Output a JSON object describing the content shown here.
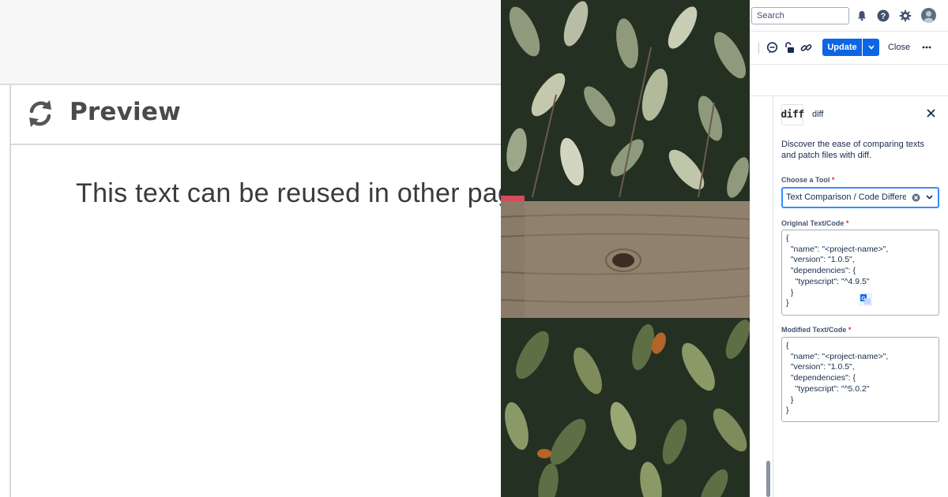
{
  "preview": {
    "title": "Preview",
    "body_text": "This text can be reused in other pages, m"
  },
  "topbar": {
    "search_placeholder": "Search",
    "icons": [
      "bell-icon",
      "help-icon",
      "settings-icon",
      "avatar"
    ]
  },
  "toolbar": {
    "icons": [
      "comment-icon",
      "unlock-icon",
      "link-icon"
    ],
    "update_label": "Update",
    "close_label": "Close",
    "accent": "#0c66e4"
  },
  "panel": {
    "app_logo_text": "diff",
    "app_name": "diff",
    "description": "Discover the ease of comparing texts and patch files with diff.",
    "tool_label": "Choose a Tool",
    "tool_value": "Text Comparison / Code Difference",
    "original_label": "Original Text/Code",
    "original_code": "{\n  \"name\": \"<project-name>\",\n  \"version\": \"1.0.5\",\n  \"dependencies\": {\n    \"typescript\": \"^4.9.5\"\n  }\n}",
    "modified_label": "Modified Text/Code",
    "modified_code": "{\n  \"name\": \"<project-name>\",\n  \"version\": \"1.0.5\",\n  \"dependencies\": {\n    \"typescript\": \"^5.0.2\"\n  }\n}",
    "required_mark": "*"
  }
}
